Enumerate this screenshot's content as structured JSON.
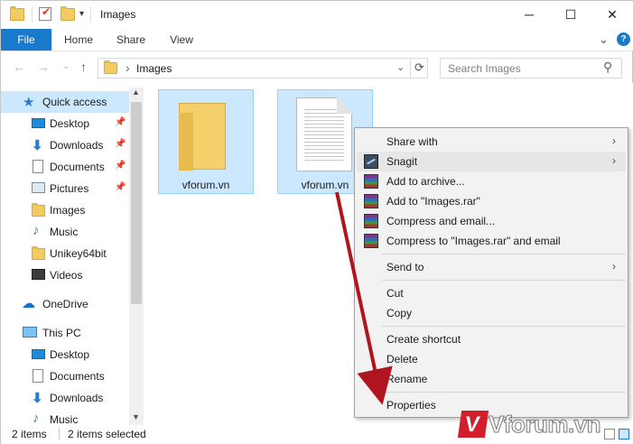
{
  "window": {
    "title": "Images",
    "controls": {
      "minimize": "─",
      "maximize": "☐",
      "close": "✕"
    }
  },
  "ribbon": {
    "tabs": [
      "File",
      "Home",
      "Share",
      "View"
    ],
    "help": "?",
    "collapse": "⌄"
  },
  "address": {
    "path": "Images",
    "separator": "›",
    "search_placeholder": "Search Images"
  },
  "nav": {
    "quick_access": "Quick access",
    "quick_items": [
      "Desktop",
      "Downloads",
      "Documents",
      "Pictures",
      "Images",
      "Music",
      "Unikey64bit",
      "Videos"
    ],
    "onedrive": "OneDrive",
    "this_pc": "This PC",
    "pc_items": [
      "Desktop",
      "Documents",
      "Downloads",
      "Music"
    ]
  },
  "files": [
    {
      "name": "vforum.vn",
      "type": "folder"
    },
    {
      "name": "vforum.vn",
      "type": "document"
    }
  ],
  "status": {
    "count": "2 items",
    "selected": "2 items selected"
  },
  "context_menu": {
    "items": [
      {
        "label": "Share with",
        "submenu": true
      },
      {
        "label": "Snagit",
        "submenu": true,
        "highlighted": true
      },
      {
        "label": "Add to archive..."
      },
      {
        "label": "Add to \"Images.rar\""
      },
      {
        "label": "Compress and email..."
      },
      {
        "label": "Compress to \"Images.rar\" and email"
      },
      {
        "label": "Send to",
        "submenu": true
      },
      {
        "label": "Cut"
      },
      {
        "label": "Copy"
      },
      {
        "label": "Create shortcut"
      },
      {
        "label": "Delete"
      },
      {
        "label": "Rename"
      },
      {
        "label": "Properties"
      }
    ]
  },
  "watermark": "Vforum.vn",
  "colors": {
    "accent": "#1979ca",
    "selection": "#cce8ff",
    "arrow": "#b0141e"
  }
}
